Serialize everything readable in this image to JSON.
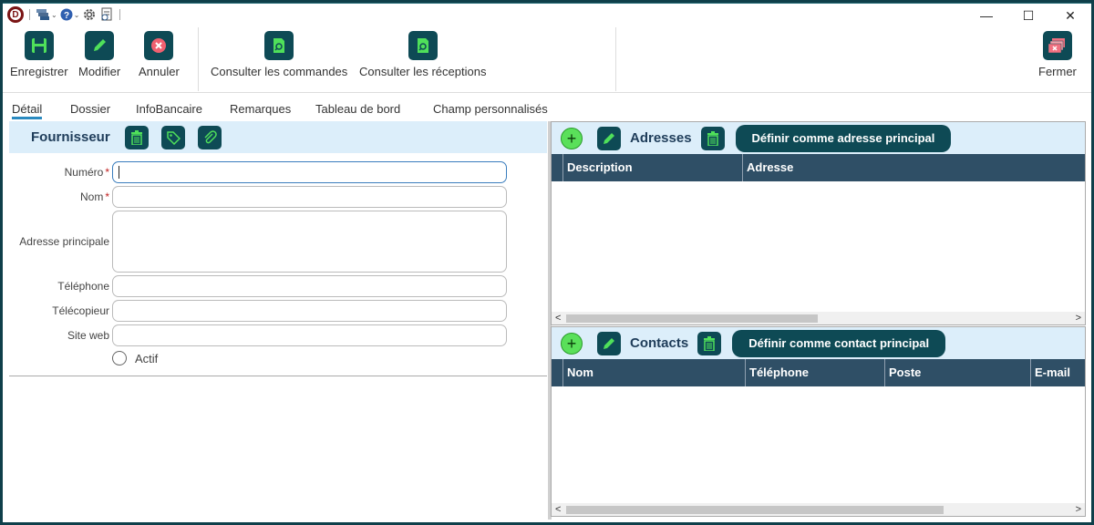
{
  "titlebar": {
    "logo_letter": "D",
    "controls": {
      "minimize": "—",
      "maximize": "☐",
      "close": "✕"
    }
  },
  "ribbon": {
    "save_label": "Enregistrer",
    "modify_label": "Modifier",
    "cancel_label": "Annuler",
    "orders_label": "Consulter les commandes",
    "receptions_label": "Consulter les réceptions",
    "close_label": "Fermer"
  },
  "tabs": [
    "Détail",
    "Dossier",
    "InfoBancaire",
    "Remarques",
    "Tableau de bord",
    "Champ personnalisés"
  ],
  "supplier": {
    "title": "Fournisseur",
    "fields": {
      "number": {
        "label": "Numéro",
        "required": "*",
        "value": ""
      },
      "name": {
        "label": "Nom",
        "required": "*",
        "value": ""
      },
      "address": {
        "label": "Adresse principale",
        "value": ""
      },
      "phone": {
        "label": "Téléphone",
        "value": ""
      },
      "fax": {
        "label": "Télécopieur",
        "value": ""
      },
      "website": {
        "label": "Site web",
        "value": ""
      }
    },
    "active_label": "Actif"
  },
  "addresses": {
    "title": "Adresses",
    "set_main_label": "Définir comme adresse principal",
    "columns": [
      "Description",
      "Adresse"
    ],
    "rows": []
  },
  "contacts": {
    "title": "Contacts",
    "set_main_label": "Définir comme contact principal",
    "columns": [
      "Nom",
      "Téléphone",
      "Poste",
      "E-mail"
    ],
    "rows": []
  },
  "colors": {
    "accent": "#0e4a55",
    "header_bg": "#dceefa",
    "grid_header": "#2f4f66",
    "add_green": "#5ae05a"
  }
}
